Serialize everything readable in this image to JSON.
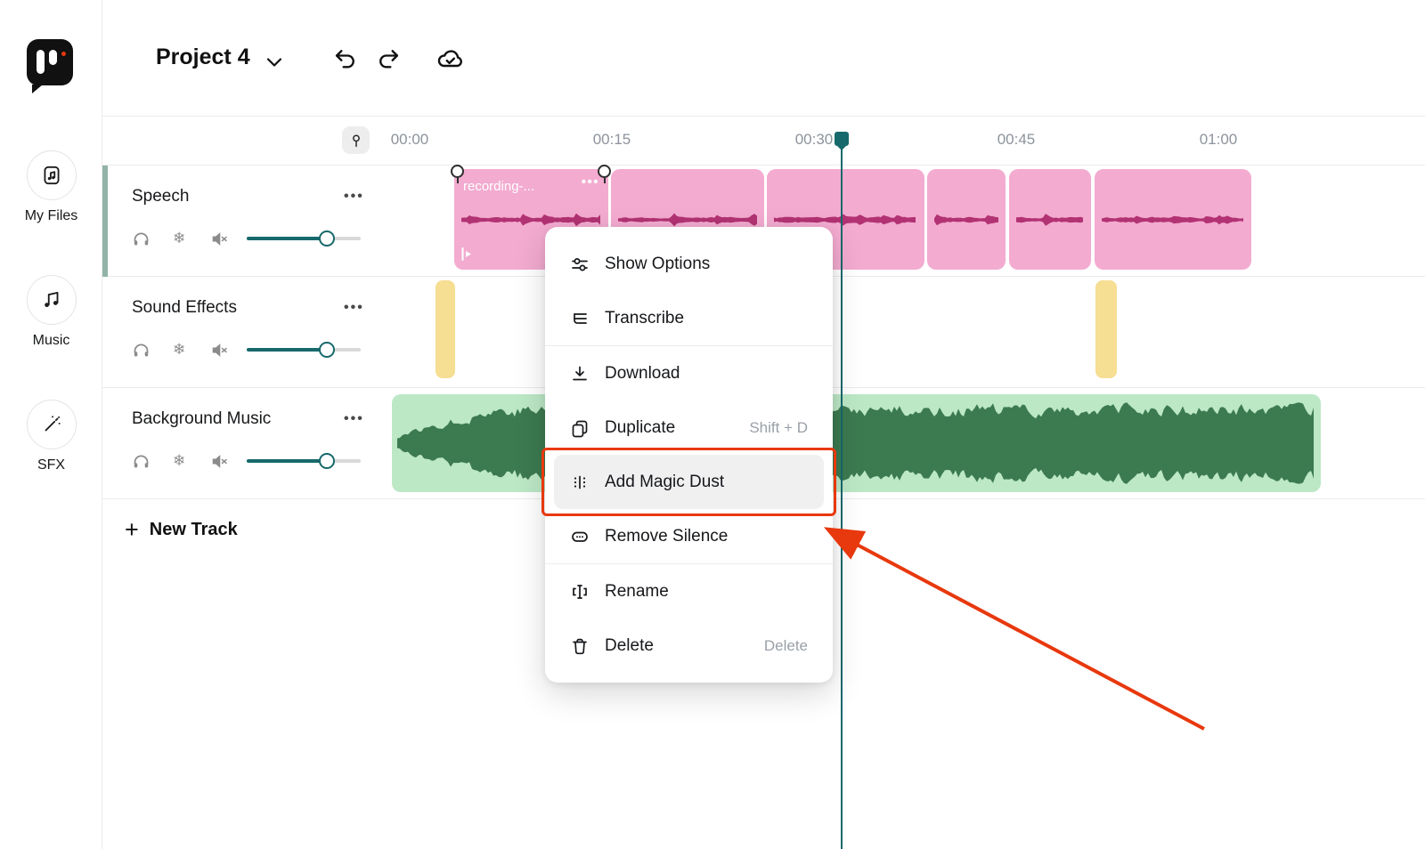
{
  "header": {
    "project_name": "Project 4"
  },
  "sidebar": {
    "items": [
      {
        "label": "My Files",
        "icon": "file-music-icon"
      },
      {
        "label": "Music",
        "icon": "music-notes-icon"
      },
      {
        "label": "SFX",
        "icon": "magic-wand-icon"
      }
    ]
  },
  "timeline": {
    "ruler_labels": [
      "00:00",
      "00:15",
      "00:30",
      "00:45",
      "01:00"
    ]
  },
  "tracks": [
    {
      "name": "Speech"
    },
    {
      "name": "Sound Effects"
    },
    {
      "name": "Background Music"
    }
  ],
  "track_controls": {
    "menu_dots": "•••",
    "icons": [
      "headphones-icon",
      "snowflake-icon",
      "mute-icon",
      "volume-slider"
    ],
    "snowflake_glyph": "❄"
  },
  "clips": {
    "speech_first_label": "recording-..."
  },
  "new_track": {
    "plus": "+",
    "label": "New Track"
  },
  "context_menu": {
    "items": [
      {
        "label": "Show Options",
        "icon": "sliders-icon"
      },
      {
        "label": "Transcribe",
        "icon": "transcribe-icon"
      },
      {
        "label": "Download",
        "icon": "download-icon"
      },
      {
        "label": "Duplicate",
        "shortcut": "Shift + D",
        "icon": "duplicate-icon"
      },
      {
        "label": "Add Magic Dust",
        "icon": "magic-dust-icon",
        "highlighted": true
      },
      {
        "label": "Remove Silence",
        "icon": "remove-silence-icon"
      },
      {
        "label": "Rename",
        "icon": "rename-icon"
      },
      {
        "label": "Delete",
        "shortcut": "Delete",
        "icon": "trash-icon"
      }
    ]
  },
  "colors": {
    "accent_teal": "#17696b",
    "clip_pink": "#f3abd0",
    "waveform_pink": "#b23273",
    "clip_yellow": "#f6de92",
    "clip_green": "#bce8c6",
    "waveform_green": "#3c7a50",
    "annotation_red": "#e8380d"
  }
}
